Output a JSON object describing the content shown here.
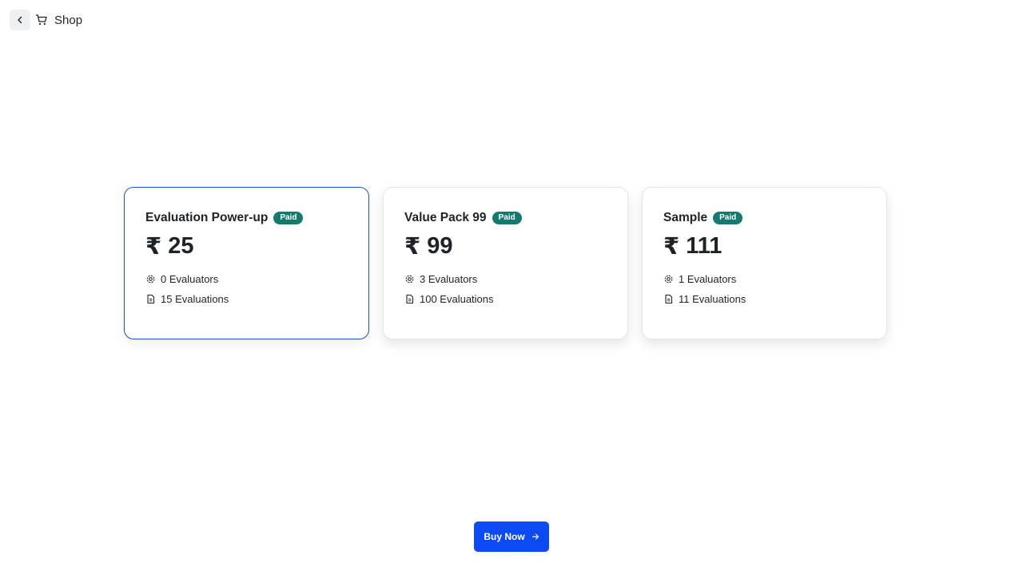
{
  "header": {
    "back_icon": "chevron-left-icon",
    "cart_icon": "shopping-cart-icon",
    "title": "Shop"
  },
  "plans": [
    {
      "name": "Evaluation Power-up",
      "badge": "Paid",
      "currency": "₹",
      "price": "25",
      "evaluators": "0 Evaluators",
      "evaluations": "15 Evaluations",
      "selected": true
    },
    {
      "name": "Value Pack 99",
      "badge": "Paid",
      "currency": "₹",
      "price": "99",
      "evaluators": "3 Evaluators",
      "evaluations": "100 Evaluations",
      "selected": false
    },
    {
      "name": "Sample",
      "badge": "Paid",
      "currency": "₹",
      "price": "111",
      "evaluators": "1 Evaluators",
      "evaluations": "11 Evaluations",
      "selected": false
    }
  ],
  "buy_button": {
    "label": "Buy Now",
    "icon": "arrow-right-icon"
  },
  "colors": {
    "accent": "#0b4af5",
    "selected_border": "#1d4ed8",
    "badge_bg": "#147a6d"
  }
}
